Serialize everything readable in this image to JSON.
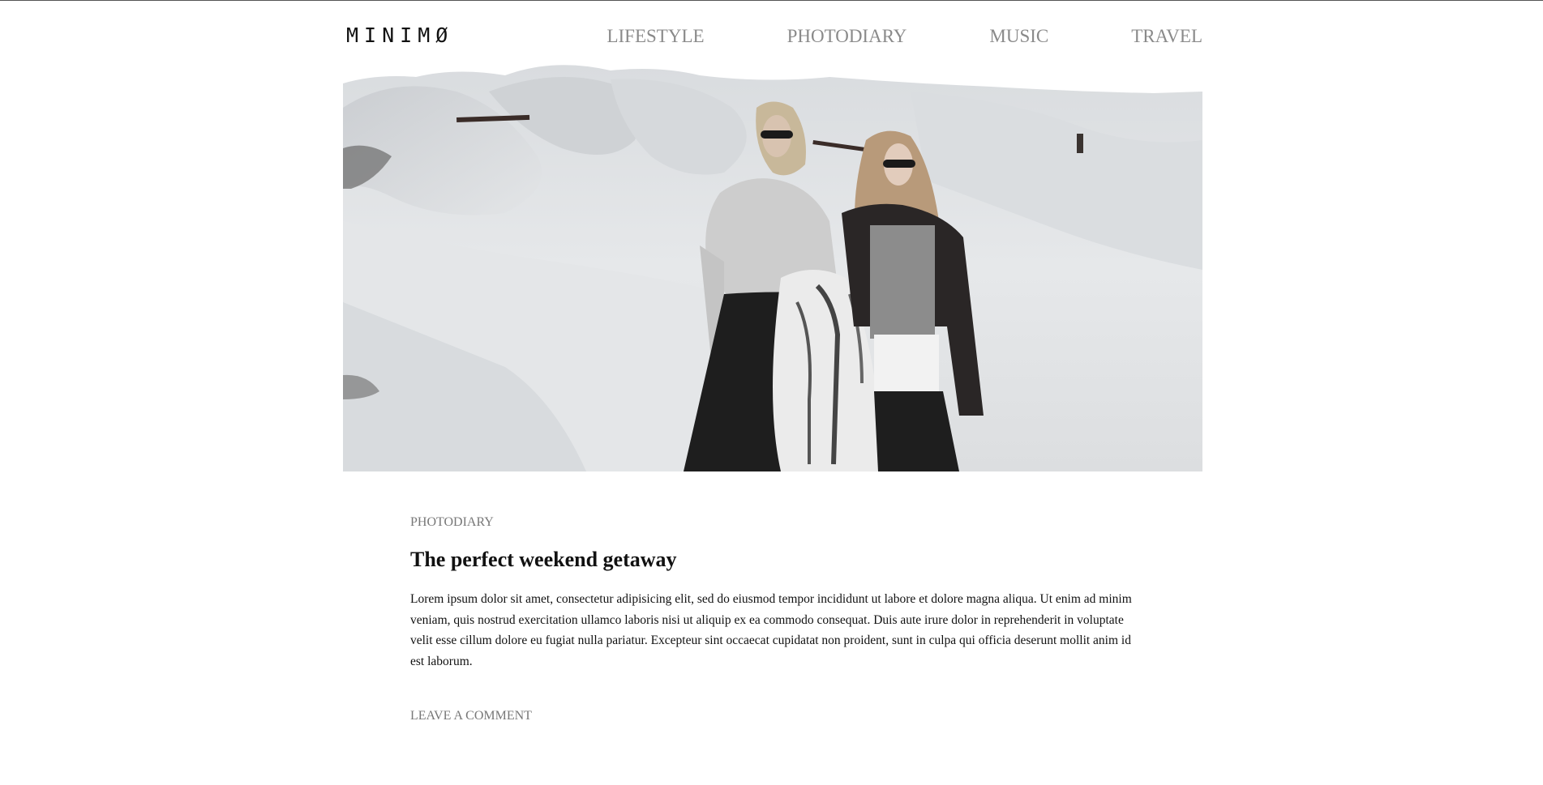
{
  "site": {
    "logo": "MINIMØ"
  },
  "nav": {
    "items": [
      {
        "label": "LIFESTYLE"
      },
      {
        "label": "PHOTODIARY"
      },
      {
        "label": "MUSIC"
      },
      {
        "label": "TRAVEL"
      }
    ]
  },
  "post": {
    "category": "PHOTODIARY",
    "title": "The perfect weekend getaway",
    "body": "Lorem ipsum dolor sit amet, consectetur adipisicing elit, sed do eiusmod tempor incididunt ut labore et dolore magna aliqua. Ut enim ad minim veniam, quis nostrud exercitation ullamco laboris nisi ut aliquip ex ea commodo consequat. Duis aute irure dolor in reprehenderit in voluptate velit esse cillum dolore eu fugiat nulla pariatur. Excepteur sint occaecat cupidatat non proident, sunt in culpa qui officia deserunt mollit anim id est laborum.",
    "comment_link": "LEAVE A COMMENT"
  },
  "colors": {
    "nav_text": "#8a8a8a",
    "meta_text": "#777777",
    "body_text": "#111111",
    "background": "#ffffff"
  }
}
